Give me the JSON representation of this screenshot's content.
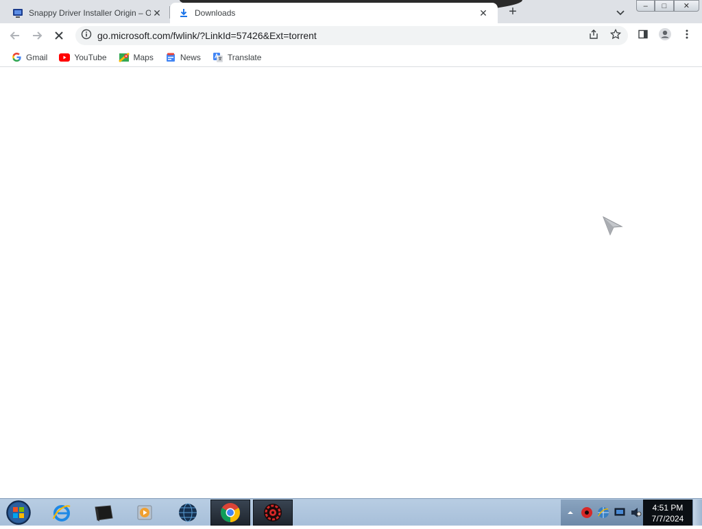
{
  "browser": {
    "tabs": [
      {
        "title": "Snappy Driver Installer Origin – Opensource",
        "favicon": "monitor-icon",
        "active": false
      },
      {
        "title": "Downloads",
        "favicon": "download-icon",
        "active": true
      }
    ],
    "new_tab_label": "+",
    "close_glyph": "✕",
    "window_controls": {
      "minimize": "–",
      "maximize": "□",
      "close": "✕"
    }
  },
  "toolbar": {
    "url": "go.microsoft.com/fwlink/?LinkId=57426&Ext=torrent",
    "loading": true
  },
  "bookmarks": [
    {
      "label": "Gmail",
      "icon": "google-icon"
    },
    {
      "label": "YouTube",
      "icon": "youtube-icon"
    },
    {
      "label": "Maps",
      "icon": "maps-icon"
    },
    {
      "label": "News",
      "icon": "news-icon"
    },
    {
      "label": "Translate",
      "icon": "translate-icon"
    }
  ],
  "taskbar": {
    "apps": [
      {
        "name": "internet-explorer",
        "icon": "ie-icon"
      },
      {
        "name": "file-manager",
        "icon": "folder-icon"
      },
      {
        "name": "media-player",
        "icon": "media-player-icon"
      },
      {
        "name": "globe-app",
        "icon": "globe-icon"
      },
      {
        "name": "chrome",
        "icon": "chrome-icon"
      },
      {
        "name": "driver-installer",
        "icon": "gear-red-icon"
      }
    ],
    "clock": {
      "time": "4:51 PM",
      "date": "7/7/2024"
    }
  },
  "colors": {
    "tabstrip": "#dee1e6",
    "omnibox": "#f1f3f4",
    "taskbar": "#a7bfd9",
    "youtube_red": "#ff0000",
    "google_blue": "#4285f4"
  }
}
